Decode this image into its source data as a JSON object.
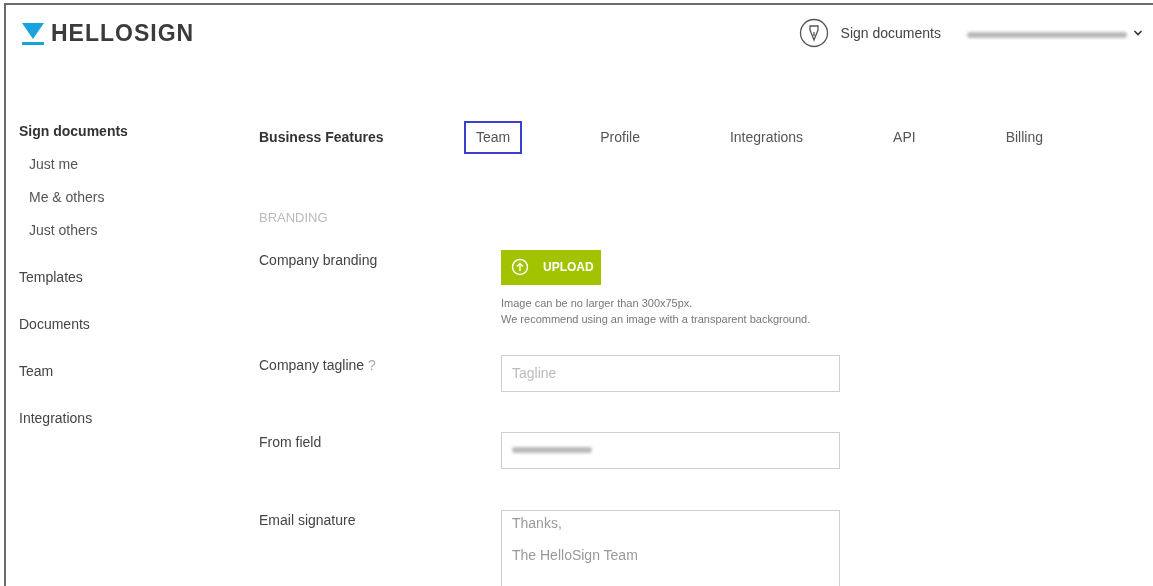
{
  "header": {
    "logo": "HELLOSIGN",
    "sign_link": "Sign documents",
    "account": {
      "redacted": true
    }
  },
  "sidebar": {
    "items": [
      {
        "label": "Sign documents",
        "children": [
          {
            "label": "Just me"
          },
          {
            "label": "Me & others"
          },
          {
            "label": "Just others"
          }
        ]
      },
      {
        "label": "Templates"
      },
      {
        "label": "Documents"
      },
      {
        "label": "Team"
      },
      {
        "label": "Integrations"
      }
    ]
  },
  "nav": {
    "heading": "Business Features",
    "tabs": [
      {
        "label": "Team",
        "selected": true
      },
      {
        "label": "Profile",
        "selected": false
      },
      {
        "label": "Integrations",
        "selected": false
      },
      {
        "label": "API",
        "selected": false
      },
      {
        "label": "Billing",
        "selected": false
      }
    ]
  },
  "section_title": "BRANDING",
  "fields": [
    {
      "kind": "upload",
      "label": "Company branding",
      "button": "UPLOAD",
      "hint": [
        "Image can be no larger than 300x75px.",
        "We recommend using an image with a transparent background."
      ]
    },
    {
      "kind": "text",
      "label": "Company tagline",
      "help": "?",
      "placeholder": "Tagline"
    },
    {
      "kind": "text",
      "label": "From field",
      "redacted": true
    },
    {
      "kind": "textarea",
      "label": "Email signature",
      "value": "Thanks,\n\nThe HelloSign Team"
    }
  ]
}
